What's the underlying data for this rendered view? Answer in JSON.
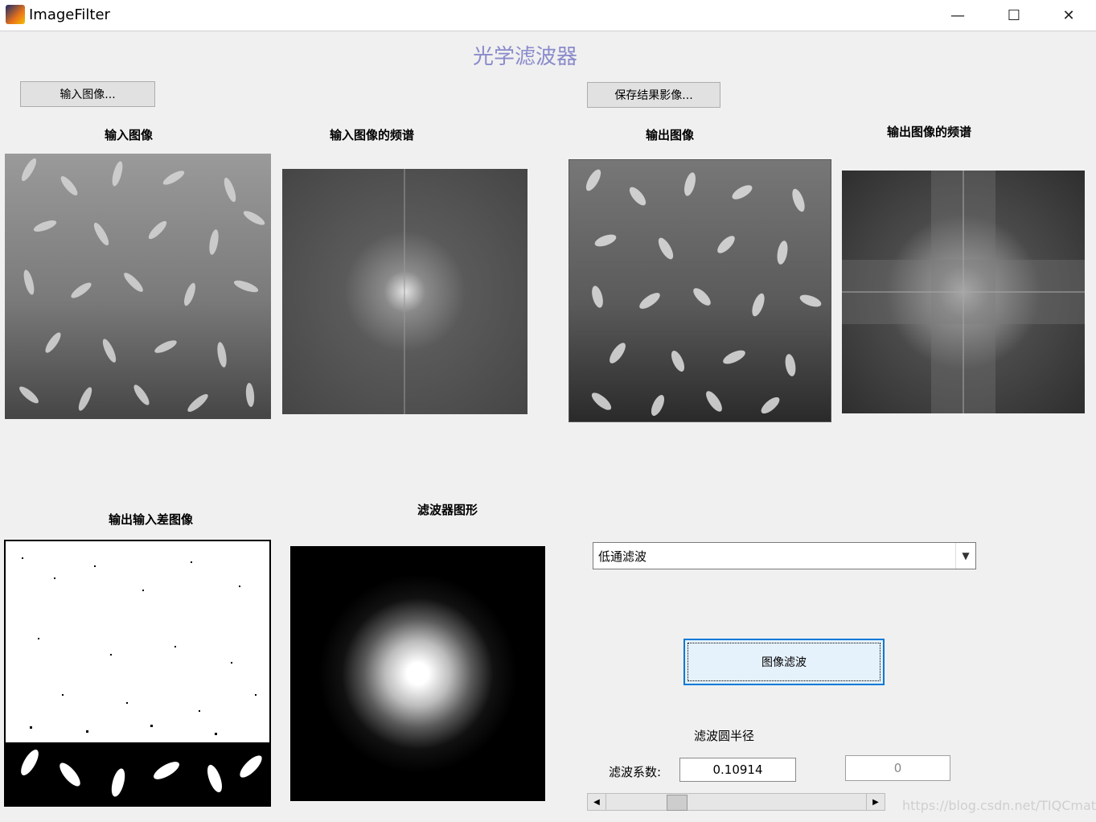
{
  "window": {
    "title": "ImageFilter",
    "controls": {
      "minimize": "—",
      "maximize": "☐",
      "close": "✕"
    }
  },
  "main": {
    "title": "光学滤波器",
    "buttons": {
      "load_image": "输入图像...",
      "save_result": "保存结果影像...",
      "filter": "图像滤波"
    },
    "panels": {
      "input_image": "输入图像",
      "input_spectrum": "输入图像的频谱",
      "output_image": "输出图像",
      "output_spectrum": "输出图像的频谱",
      "difference_image": "输出输入差图像",
      "filter_shape": "滤波器图形"
    },
    "filter_type": {
      "selected": "低通滤波"
    },
    "radius_label": "滤波圆半径",
    "coefficient_label": "滤波系数:",
    "coefficient_value": "0.10914",
    "secondary_value": "0",
    "slider": {
      "value_fraction": 0.25
    }
  },
  "watermark": "https://blog.csdn.net/TIQCmatlab"
}
